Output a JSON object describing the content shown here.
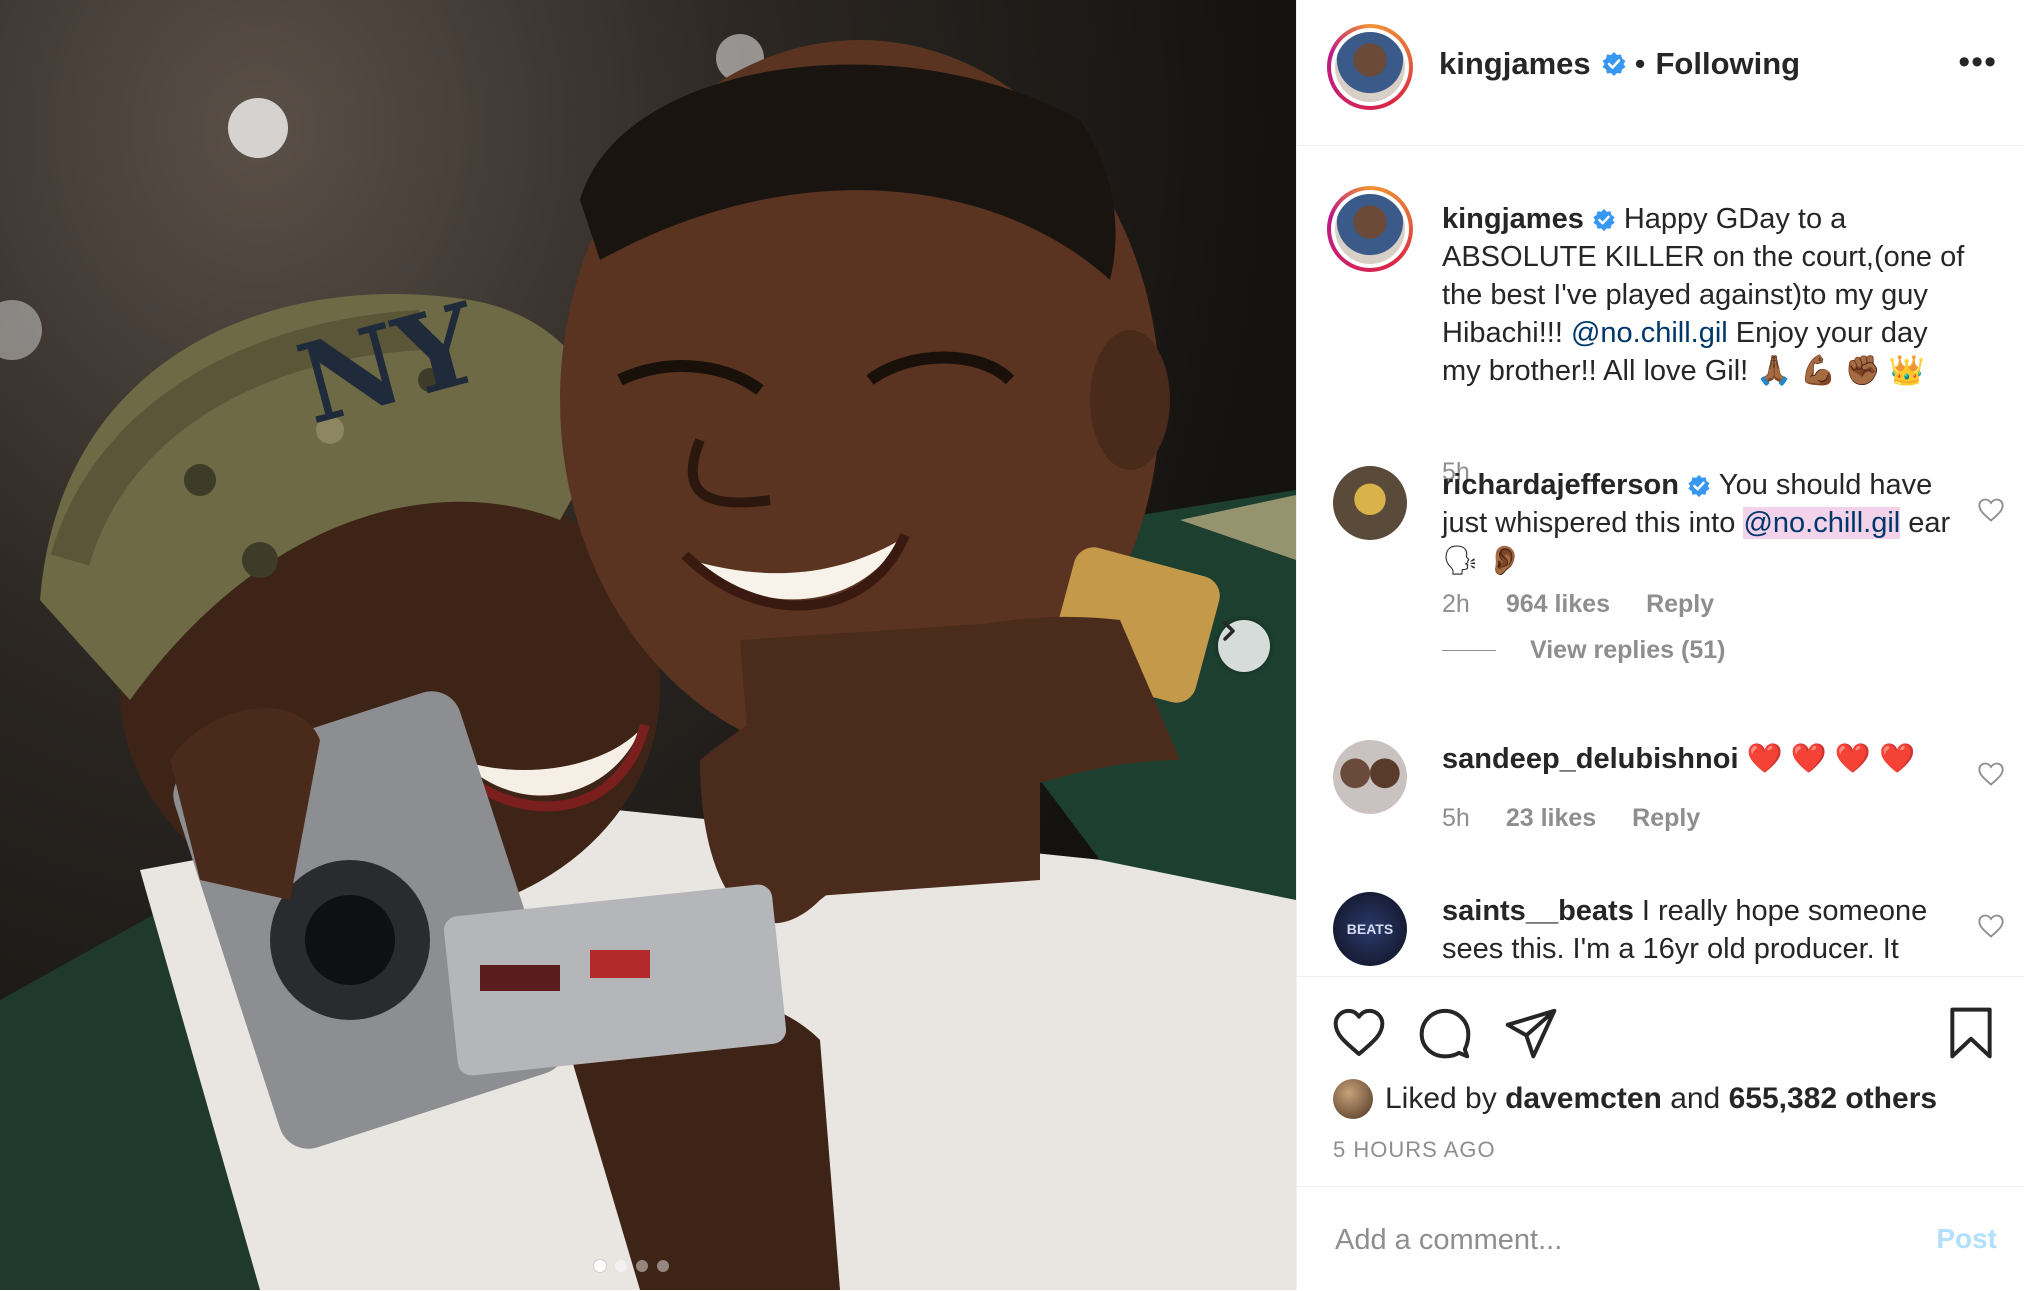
{
  "photo": {
    "carousel_total": 4,
    "carousel_active": 1
  },
  "header": {
    "username": "kingjames",
    "separator": "•",
    "following_label": "Following",
    "more_label": "•••"
  },
  "caption": {
    "username": "kingjames",
    "text_1": "Happy GDay to a ABSOLUTE KILLER on the court,(one of the best I've played against)to my guy Hibachi!!!",
    "mention": "@no.chill.gil",
    "text_2": "Enjoy your day my brother!! All love Gil! 🙏🏾 💪🏾 ✊🏾 👑",
    "time": "5h"
  },
  "comments": [
    {
      "username": "richardajefferson",
      "text_1": "You should have just whispered this into",
      "mention": "@no.chill.gil",
      "text_2": "ear 🗣 👂🏾",
      "time": "2h",
      "likes": "964 likes",
      "reply": "Reply",
      "view_replies": "View replies (51)"
    },
    {
      "username": "sandeep_delubishnoi",
      "text": "❤️ ❤️ ❤️ ❤️",
      "time": "5h",
      "likes": "23 likes",
      "reply": "Reply"
    },
    {
      "username": "saints__beats",
      "text": "I really hope someone sees this. I'm a 16yr old producer. It",
      "avatar_text": "BEATS"
    }
  ],
  "actions": {
    "liked_by_prefix": "Liked by",
    "liked_by_user": "davemcten",
    "liked_by_and": "and",
    "liked_by_others": "655,382 others",
    "time_ago": "5 HOURS AGO"
  },
  "add_comment": {
    "placeholder": "Add a comment...",
    "post_label": "Post"
  },
  "colors": {
    "verified": "#3897f0",
    "mention": "#00376b",
    "mention_highlight": "#f3d3ea",
    "post_disabled": "#b2dffc",
    "meta": "#8e8e8e"
  }
}
